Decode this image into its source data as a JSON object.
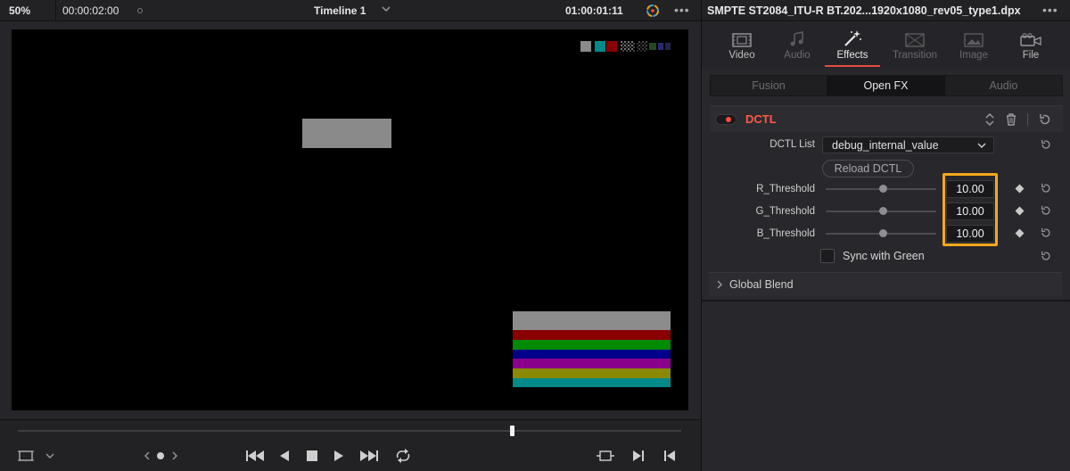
{
  "topbar": {
    "zoom": "50%",
    "source_timecode": "00:00:02:00",
    "timeline_name": "Timeline 1",
    "record_timecode": "01:00:01:11"
  },
  "inspector": {
    "file_title": "SMPTE ST2084_ITU-R BT.202...1920x1080_rev05_type1.dpx",
    "tabs": [
      {
        "label": "Video",
        "icon": "filmstrip-icon",
        "state": "normal"
      },
      {
        "label": "Audio",
        "icon": "music-note-icon",
        "state": "disabled"
      },
      {
        "label": "Effects",
        "icon": "magic-wand-icon",
        "state": "active"
      },
      {
        "label": "Transition",
        "icon": "transition-icon",
        "state": "disabled"
      },
      {
        "label": "Image",
        "icon": "image-icon",
        "state": "disabled"
      },
      {
        "label": "File",
        "icon": "camera-icon",
        "state": "normal"
      }
    ],
    "subtabs": {
      "fusion": "Fusion",
      "openfx": "Open FX",
      "audio": "Audio"
    },
    "effect": {
      "name": "DCTL",
      "enabled": true,
      "dctl_list_label": "DCTL List",
      "dctl_list_value": "debug_internal_value",
      "reload_label": "Reload DCTL",
      "params": [
        {
          "label": "R_Threshold",
          "value": "10.00",
          "slider_fraction": 0.52
        },
        {
          "label": "G_Threshold",
          "value": "10.00",
          "slider_fraction": 0.52
        },
        {
          "label": "B_Threshold",
          "value": "10.00",
          "slider_fraction": 0.52
        }
      ],
      "sync_label": "Sync with Green",
      "sync_checked": false
    },
    "global_blend_label": "Global Blend"
  },
  "colors": {
    "accent_red": "#e64b3c",
    "highlight_orange": "#f5a81c",
    "bars": [
      "#8c8c8c",
      "#8a0000",
      "#008a00",
      "#00008a",
      "#8a008a",
      "#8a8a00",
      "#008a8a"
    ],
    "corner_chips": [
      "#8a8a8a",
      "#008a8a",
      "#8a0000"
    ]
  }
}
